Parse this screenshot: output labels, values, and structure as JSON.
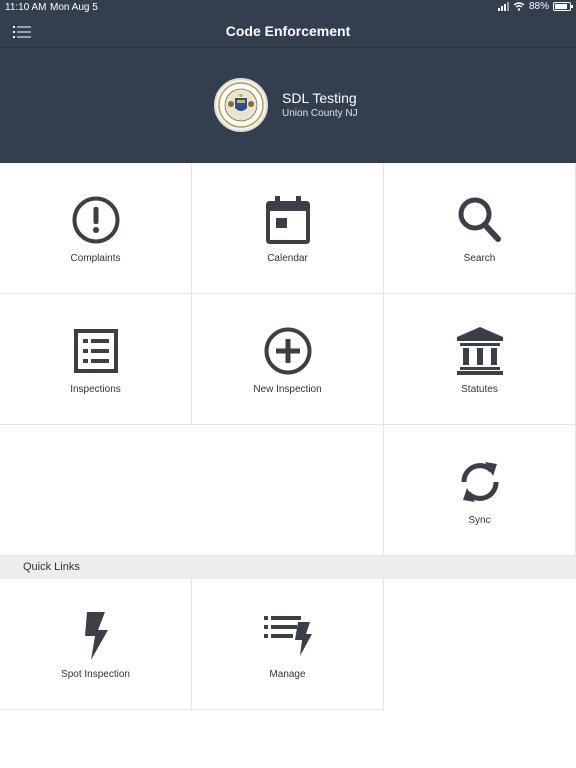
{
  "status_bar": {
    "time": "11:10 AM",
    "date": "Mon Aug 5",
    "battery": "88%",
    "battery_level": 0.88
  },
  "navbar": {
    "title": "Code Enforcement",
    "menu_icon": "list-menu-icon"
  },
  "profile": {
    "name": "SDL Testing",
    "subtitle": "Union County NJ",
    "logo": "state-seal"
  },
  "tiles": [
    {
      "label": "Complaints",
      "icon": "exclamation-circle-icon"
    },
    {
      "label": "Calendar",
      "icon": "calendar-icon"
    },
    {
      "label": "Search",
      "icon": "search-icon"
    },
    {
      "label": "Inspections",
      "icon": "checklist-icon"
    },
    {
      "label": "New Inspection",
      "icon": "plus-circle-icon"
    },
    {
      "label": "Statutes",
      "icon": "institution-icon"
    },
    {
      "label": "Sync",
      "icon": "sync-icon"
    }
  ],
  "quick_links": {
    "title": "Quick Links",
    "items": [
      {
        "label": "Spot Inspection",
        "icon": "lightning-icon"
      },
      {
        "label": "Manage",
        "icon": "manage-list-icon"
      }
    ]
  },
  "colors": {
    "header_bg": "#333f4f",
    "icon": "#3b3f48",
    "section_bg": "#ededed"
  }
}
